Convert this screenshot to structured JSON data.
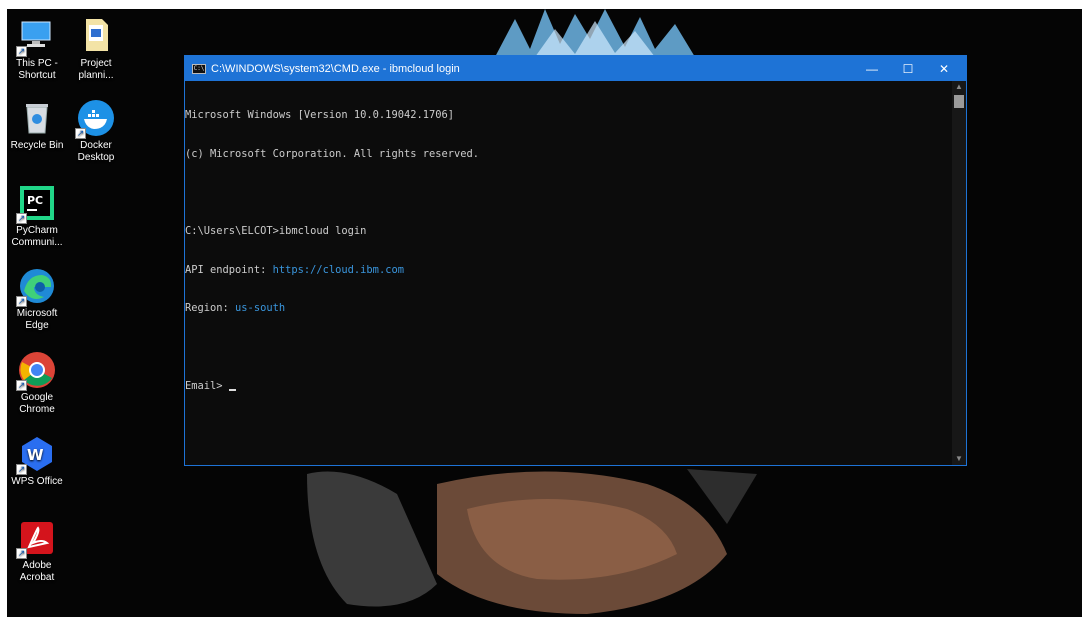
{
  "desktop": {
    "icons": [
      {
        "label": "This PC - Shortcut",
        "line1": "This PC -",
        "line2": "Shortcut",
        "icon": "monitor-icon"
      },
      {
        "label": "Project planni...",
        "line1": "Project",
        "line2": "planni...",
        "icon": "document-icon"
      },
      {
        "label": "Recycle Bin",
        "line1": "Recycle Bin",
        "line2": "",
        "icon": "recycle-bin-icon"
      },
      {
        "label": "Docker Desktop",
        "line1": "Docker",
        "line2": "Desktop",
        "icon": "docker-icon"
      },
      {
        "label": "PyCharm Communi...",
        "line1": "PyCharm",
        "line2": "Communi...",
        "icon": "pycharm-icon"
      },
      {
        "label": "Microsoft Edge",
        "line1": "Microsoft",
        "line2": "Edge",
        "icon": "edge-icon"
      },
      {
        "label": "Google Chrome",
        "line1": "Google",
        "line2": "Chrome",
        "icon": "chrome-icon"
      },
      {
        "label": "WPS Office",
        "line1": "WPS Office",
        "line2": "",
        "icon": "wps-office-icon"
      },
      {
        "label": "Adobe Acrobat",
        "line1": "Adobe",
        "line2": "Acrobat",
        "icon": "acrobat-icon"
      }
    ]
  },
  "cmd_window": {
    "title": "C:\\WINDOWS\\system32\\CMD.exe - ibmcloud  login",
    "icon_text": "C:\\",
    "controls": {
      "minimize": "—",
      "maximize": "☐",
      "close": "✕"
    },
    "console_lines": [
      "Microsoft Windows [Version 10.0.19042.1706]",
      "(c) Microsoft Corporation. All rights reserved.",
      "",
      "C:\\Users\\ELCOT>ibmcloud login",
      "API endpoint: https://cloud.ibm.com",
      "Region: us-south",
      "",
      "Email> "
    ],
    "accent_color": "#1e73d6",
    "console_bg": "#0c0c0c",
    "url_color": "#3a96dd"
  }
}
